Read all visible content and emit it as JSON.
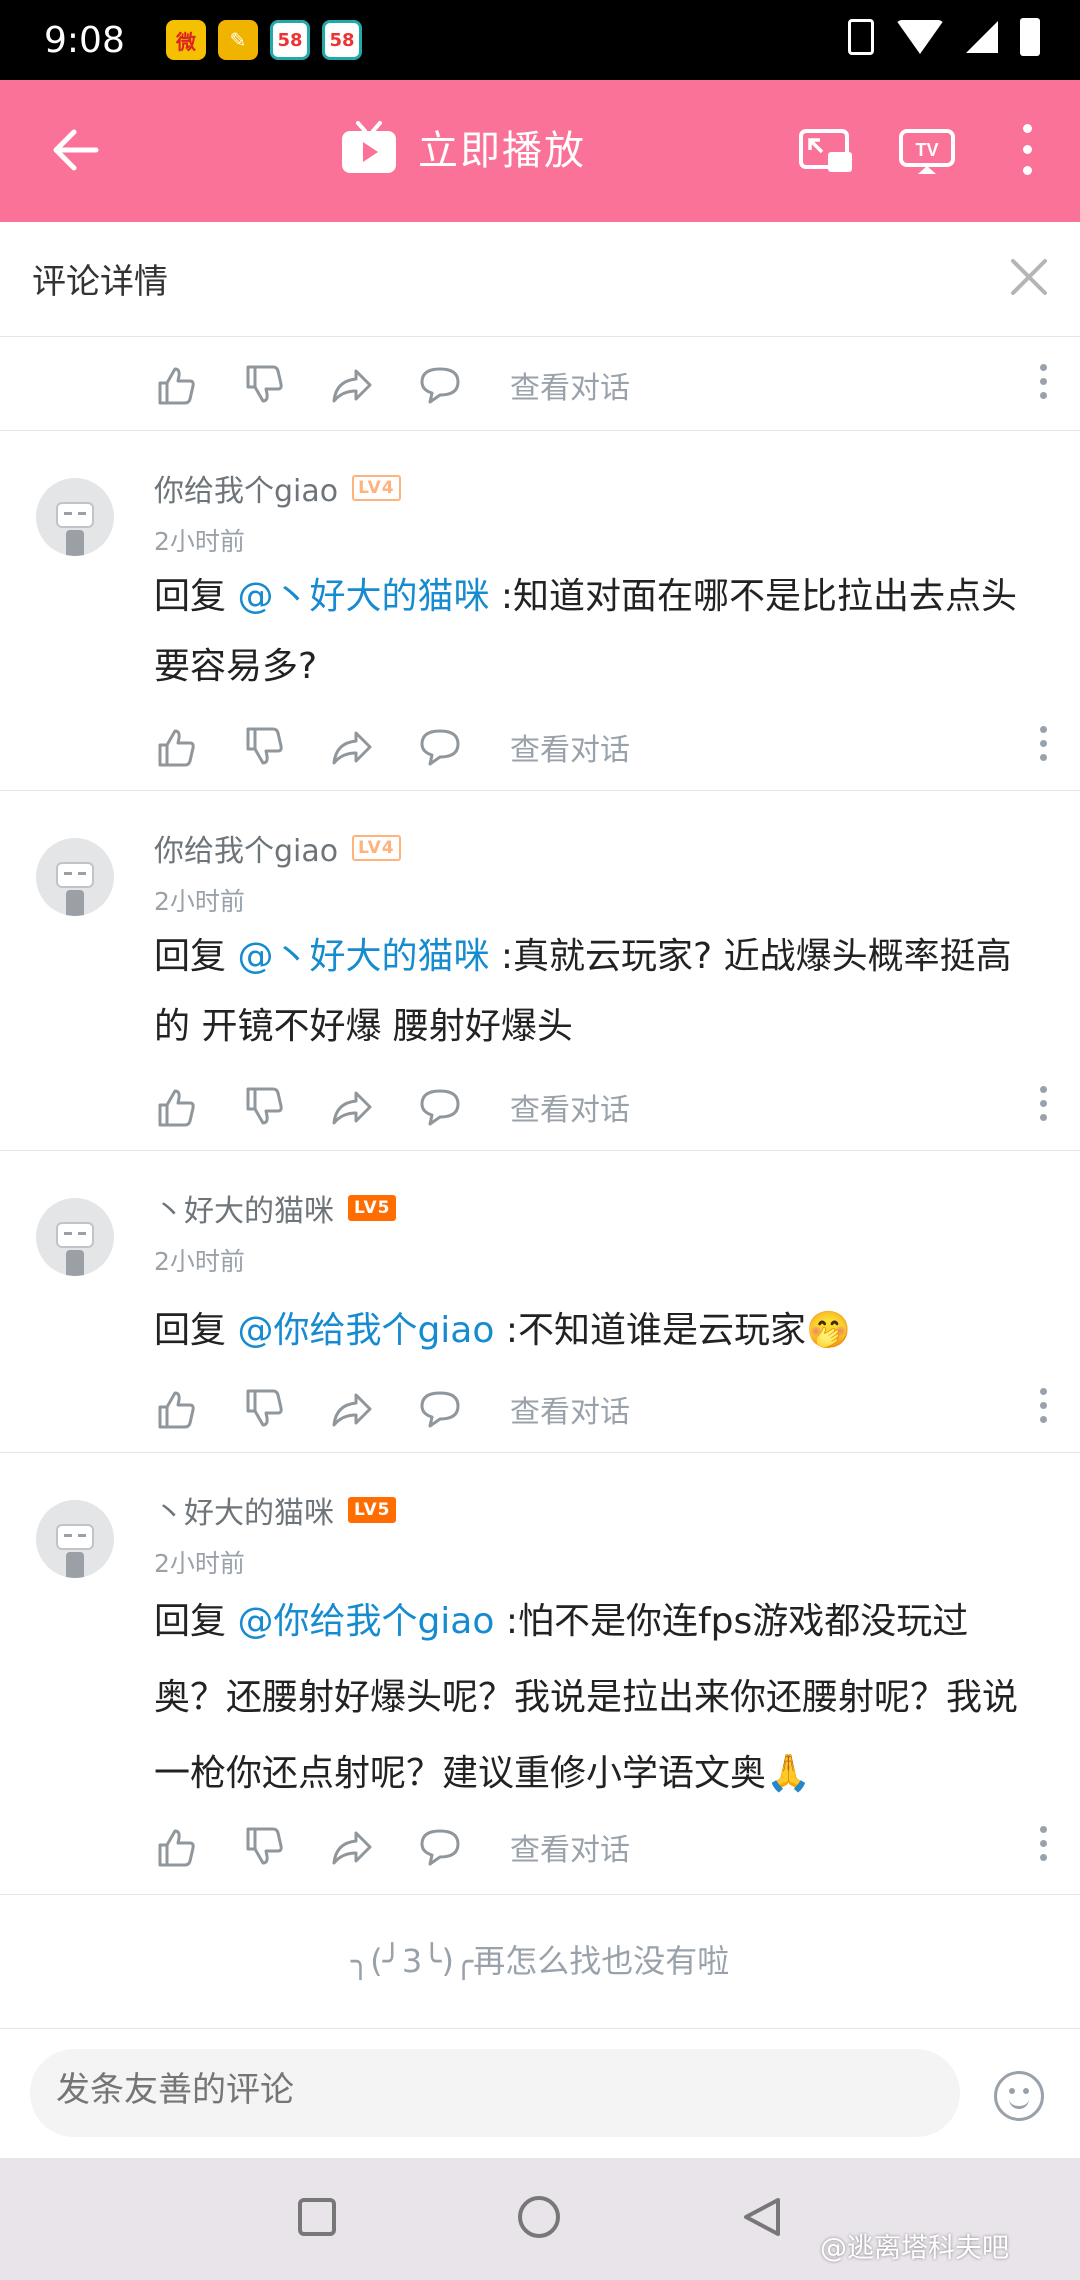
{
  "status_bar": {
    "time": "9:08",
    "notifications": [
      "weibo",
      "edit",
      "58",
      "58"
    ]
  },
  "toolbar": {
    "play_label": "立即播放"
  },
  "detail": {
    "title": "评论详情"
  },
  "actions_label": "查看对话",
  "comments": [
    {
      "user": "你给我个giao",
      "level": "LV4",
      "time": "2小时前",
      "reply_prefix": "回复 ",
      "mention": "@丶好大的猫咪",
      "text": " :知道对面在哪不是比拉出去点头要容易多?",
      "emoji": ""
    },
    {
      "user": "你给我个giao",
      "level": "LV4",
      "time": "2小时前",
      "reply_prefix": "回复 ",
      "mention": "@丶好大的猫咪",
      "text": " :真就云玩家? 近战爆头概率挺高的 开镜不好爆 腰射好爆头",
      "emoji": ""
    },
    {
      "user": "丶好大的猫咪",
      "level": "LV5",
      "time": "2小时前",
      "reply_prefix": "回复 ",
      "mention": "@你给我个giao",
      "text": " :不知道谁是云玩家",
      "emoji": "🤭"
    },
    {
      "user": "丶好大的猫咪",
      "level": "LV5",
      "time": "2小时前",
      "reply_prefix": "回复 ",
      "mention": "@你给我个giao",
      "text": " :怕不是你连fps游戏都没玩过奥？还腰射好爆头呢？我说是拉出来你还腰射呢？我说一枪你还点射呢？建议重修小学语文奥",
      "emoji": "🙏"
    }
  ],
  "end_message": "╮(╯3╰)╭再怎么找也没有啦",
  "input": {
    "placeholder": "发条友善的评论"
  },
  "watermark": "@逃离塔科夫吧",
  "colors": {
    "accent": "#fb7299",
    "mention": "#178bcf",
    "lv4": "#ffb37c",
    "lv5": "#ff6c00"
  }
}
